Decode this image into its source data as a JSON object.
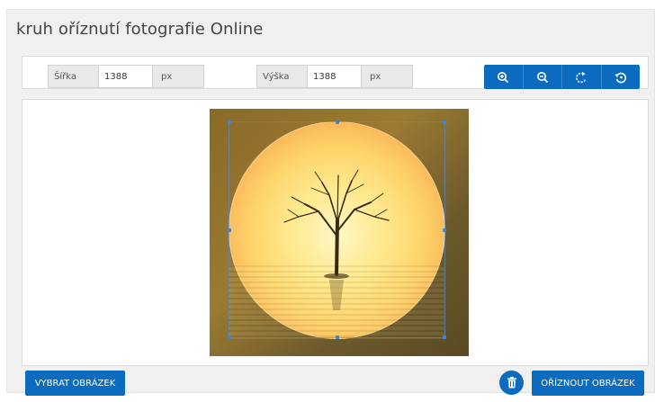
{
  "page": {
    "title": "kruh oříznutí fotografie Online"
  },
  "toolbar": {
    "width_label": "Šířka",
    "width_value": "1388",
    "width_unit": "px",
    "height_label": "Výška",
    "height_value": "1388",
    "height_unit": "px",
    "buttons": [
      {
        "icon": "zoom-in-icon"
      },
      {
        "icon": "zoom-out-icon"
      },
      {
        "icon": "rotate-icon"
      },
      {
        "icon": "reset-icon"
      }
    ]
  },
  "image": {
    "description": "photo-tree-in-circle"
  },
  "actions": {
    "select_image": "VYBRAT OBRÁZEK",
    "crop_image": "OŘÍZNOUT OBRÁZEK",
    "delete_icon": "trash-icon"
  },
  "colors": {
    "primary": "#0a6bbf",
    "panel_bg": "#f0f0f0"
  }
}
